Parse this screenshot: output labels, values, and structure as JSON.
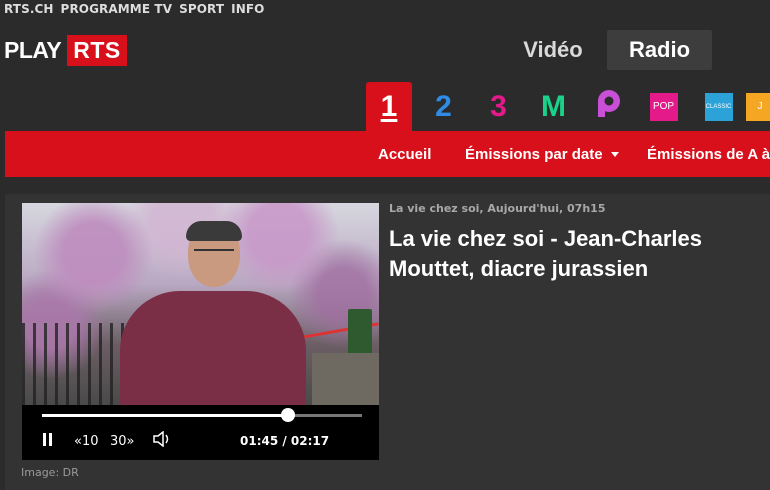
{
  "top_nav": {
    "items": [
      "RTS.CH",
      "PROGRAMME TV",
      "SPORT",
      "INFO"
    ]
  },
  "logo": {
    "play": "PLAY",
    "rts": "RTS"
  },
  "media_tabs": {
    "video": "Vidéo",
    "radio": "Radio",
    "active": "Radio"
  },
  "channels": [
    {
      "label": "1",
      "icon": "la-1ere-icon",
      "color": "#ffffff"
    },
    {
      "label": "2",
      "icon": "espace-2-icon",
      "color": "#2e8be6"
    },
    {
      "label": "3",
      "icon": "couleur-3-icon",
      "color": "#e51a8a"
    },
    {
      "label": "M",
      "icon": "option-musique-icon",
      "color": "#1ad38a"
    },
    {
      "label": "P",
      "icon": "podcast-icon",
      "color": "#c94fd6"
    },
    {
      "label": "POP",
      "icon": "pop-icon",
      "color": "#e51a8a"
    },
    {
      "label": "CLASSIC",
      "icon": "classic-icon",
      "color": "#2ba3d9"
    },
    {
      "label": "J",
      "icon": "jazz-icon",
      "color": "#f5a623"
    }
  ],
  "section_nav": {
    "home": "Accueil",
    "by_date": "Émissions par date",
    "a_to_z": "Émissions de A à Z"
  },
  "player": {
    "progress": 0.7686,
    "current_time": "01:45",
    "duration": "02:17",
    "time_display": "01:45 / 02:17",
    "rewind_label": "«10",
    "forward_label": "30»",
    "image_credit": "Image: DR"
  },
  "episode": {
    "meta": "La vie chez soi, Aujourd'hui, 07h15",
    "title": "La vie chez soi - Jean-Charles Mouttet, diacre jurassien"
  },
  "colors": {
    "brand_red": "#d8101b",
    "background": "#2b2b2b",
    "panel": "#333333"
  }
}
